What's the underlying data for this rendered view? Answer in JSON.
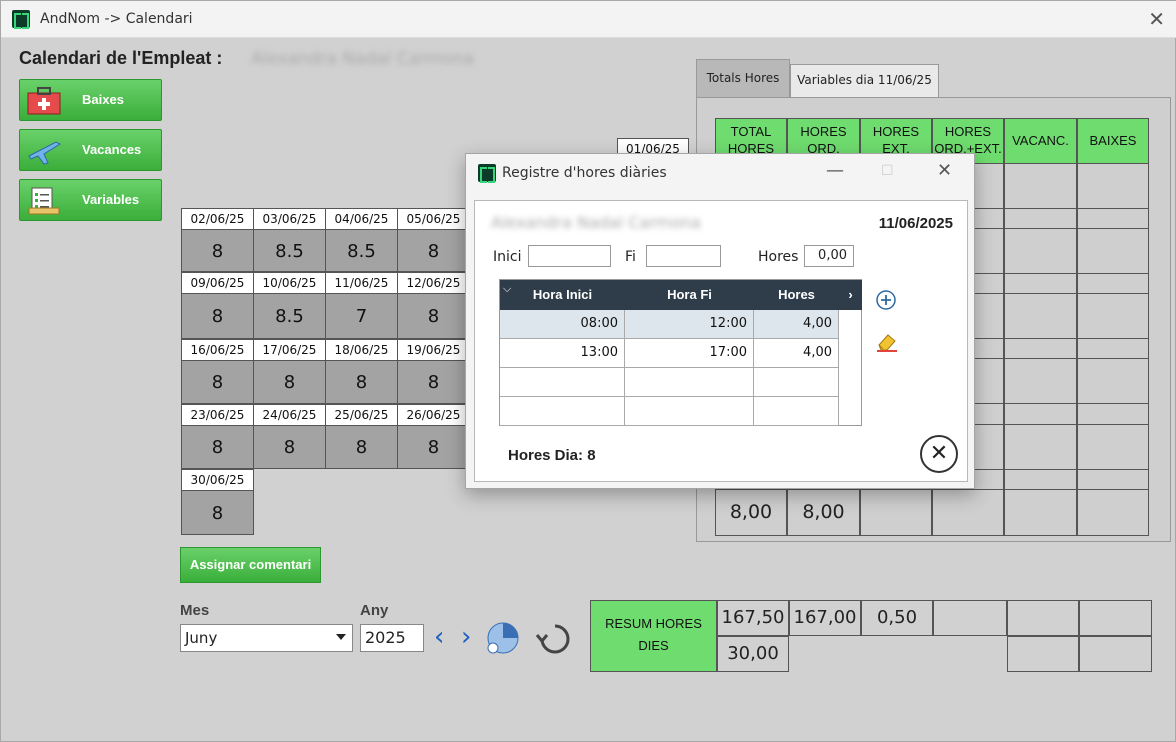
{
  "window": {
    "title": "AndNom -> Calendari"
  },
  "page": {
    "title": "Calendari de l'Empleat :",
    "employee": "Alexandra Nadal Carmona"
  },
  "side_buttons": [
    {
      "label": "Baixes"
    },
    {
      "label": "Vacances"
    },
    {
      "label": "Variables"
    }
  ],
  "calendar": {
    "first_day": {
      "date": "01/06/25"
    },
    "cells": [
      {
        "date": "02/06/25",
        "value": "8"
      },
      {
        "date": "03/06/25",
        "value": "8.5"
      },
      {
        "date": "04/06/25",
        "value": "8.5"
      },
      {
        "date": "05/06/25",
        "value": "8"
      },
      {
        "date": "09/06/25",
        "value": "8"
      },
      {
        "date": "10/06/25",
        "value": "8.5"
      },
      {
        "date": "11/06/25",
        "value": "7"
      },
      {
        "date": "12/06/25",
        "value": "8"
      },
      {
        "date": "16/06/25",
        "value": "8"
      },
      {
        "date": "17/06/25",
        "value": "8"
      },
      {
        "date": "18/06/25",
        "value": "8"
      },
      {
        "date": "19/06/25",
        "value": "8"
      },
      {
        "date": "23/06/25",
        "value": "8"
      },
      {
        "date": "24/06/25",
        "value": "8"
      },
      {
        "date": "25/06/25",
        "value": "8"
      },
      {
        "date": "26/06/25",
        "value": "8"
      },
      {
        "date": "30/06/25",
        "value": "8"
      }
    ]
  },
  "assign_comment_label": "Assignar comentari",
  "filters": {
    "month_label": "Mes",
    "month_value": "Juny",
    "year_label": "Any",
    "year_value": "2025"
  },
  "tabs": [
    {
      "label": "Totals Hores"
    },
    {
      "label": "Variables dia 11/06/25"
    }
  ],
  "totals_table": {
    "headers": [
      "TOTAL HORES",
      "HORES ORD.",
      "HORES EXT.",
      "HORES ORD.+EXT.",
      "VACANC.",
      "BAIXES"
    ],
    "totals": [
      "8,00",
      "8,00"
    ]
  },
  "resum": {
    "label": "RESUM HORES DIES",
    "row1": [
      "167,50",
      "167,00",
      "0,50"
    ],
    "row2": [
      "30,00"
    ]
  },
  "dialog": {
    "title": "Registre d'hores diàries",
    "employee": "Alexandra Nadal Carmona",
    "date": "11/06/2025",
    "inici_label": "Inici",
    "fi_label": "Fi",
    "hores_label": "Hores",
    "hores_value": "0,00",
    "columns": [
      "Hora Inici",
      "Hora Fi",
      "Hores"
    ],
    "rows": [
      {
        "inici": "08:00",
        "fi": "12:00",
        "hores": "4,00"
      },
      {
        "inici": "13:00",
        "fi": "17:00",
        "hores": "4,00"
      }
    ],
    "hores_dia": "Hores Dia: 8",
    "colors": {
      "header": "#2f3d4a",
      "selected": "#dde6ec"
    }
  }
}
